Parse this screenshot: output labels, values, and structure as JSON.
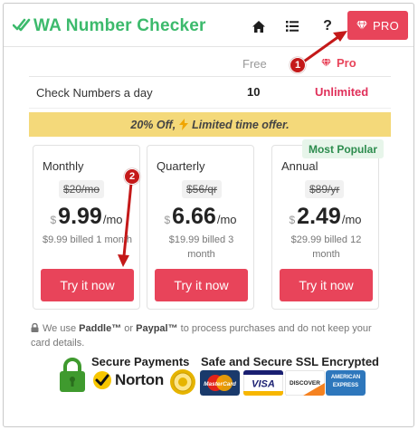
{
  "header": {
    "title": "WA Number Checker",
    "home_icon": "home-icon",
    "list_icon": "list-icon",
    "help_label": "?",
    "pro_label": "PRO",
    "pro_icon": "gem-icon",
    "brand_color": "#3cba6c",
    "accent_color": "#e8445a"
  },
  "comparison": {
    "col_free": "Free",
    "col_pro": "Pro",
    "rows": [
      {
        "label": "Check Numbers a day",
        "free": "10",
        "pro": "Unlimited"
      }
    ]
  },
  "offer": {
    "prefix": "20% Off,",
    "icon": "lightning-icon",
    "suffix": "Limited time offer."
  },
  "plans": [
    {
      "name": "Monthly",
      "old_price": "$20/mo",
      "currency": "$",
      "price": "9.99",
      "period": "/mo",
      "billed": "$9.99 billed 1 month",
      "button": "Try it now"
    },
    {
      "name": "Quarterly",
      "old_price": "$56/qr",
      "currency": "$",
      "price": "6.66",
      "period": "/mo",
      "billed": "$19.99 billed 3 month",
      "button": "Try it now"
    },
    {
      "name": "Annual",
      "old_price": "$89/yr",
      "currency": "$",
      "price": "2.49",
      "period": "/mo",
      "billed": "$29.99 billed 12 month",
      "button": "Try it now"
    }
  ],
  "popular_badge": "Most Popular",
  "footer": {
    "note_prefix": "We use",
    "paddle": "Paddle™",
    "or": "or",
    "paypal": "Paypal™",
    "note_suffix": "to process purchases and do not keep your card details.",
    "secure_payments": "Secure Payments",
    "ssl_title": "Safe and Secure SSL Encrypted",
    "norton": "Norton",
    "cards": [
      "MasterCard",
      "VISA",
      "DISCOVER",
      "AMERICAN EXPRESS"
    ]
  },
  "annotations": {
    "badge_1": "1",
    "badge_2": "2",
    "arrow_color": "#c41919"
  }
}
